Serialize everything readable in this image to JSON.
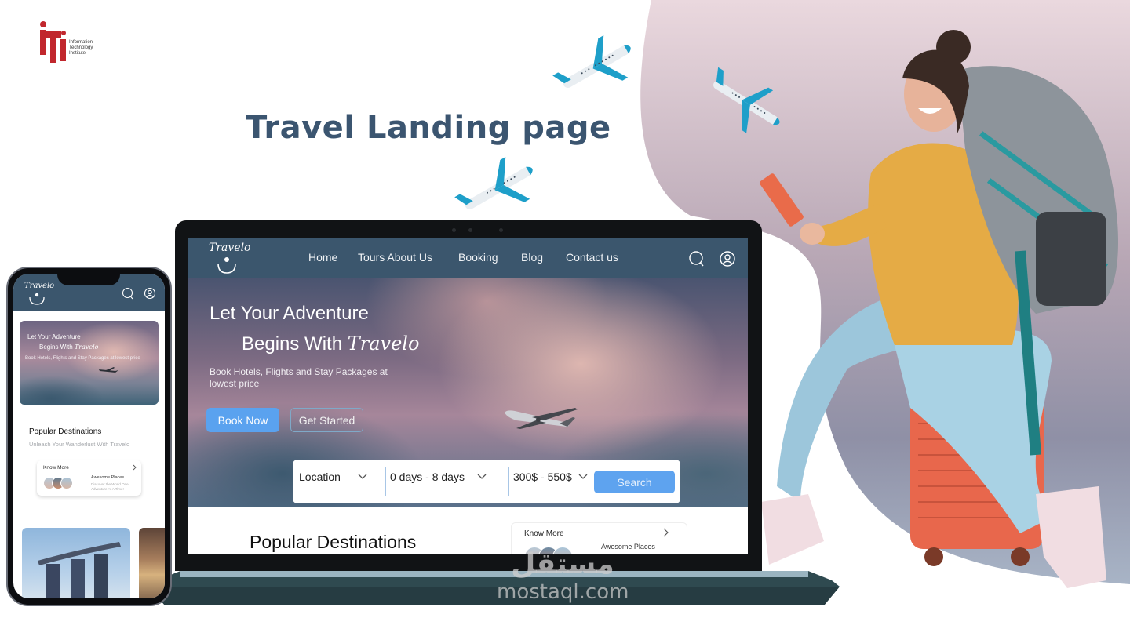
{
  "colors": {
    "nav_bg": "#3b566d",
    "title": "#3b5570",
    "primary_button": "#5aa2ef",
    "blob_top": "#e6d1da",
    "blob_bottom": "#8e8ea2",
    "iti_red": "#c1272d",
    "plane_accent": "#1e9fc9"
  },
  "institute_logo": {
    "mark": "iti",
    "lines": [
      "Information",
      "Technology",
      "Institute"
    ]
  },
  "headline": "Travel Landing page",
  "laptop_site": {
    "brand": "Travelo",
    "nav": [
      "Home",
      "Tours About Us",
      "Booking",
      "Blog",
      "Contact us"
    ],
    "icons": [
      "search-icon",
      "user-icon"
    ],
    "hero": {
      "line1": "Let Your Adventure",
      "line2_prefix": "Begins With",
      "line2_script": "Travelo",
      "subtitle": "Book Hotels, Flights and Stay Packages at lowest price",
      "primary_button": "Book Now",
      "secondary_button": "Get Started"
    },
    "search": {
      "location": "Location",
      "duration": "0 days - 8 days",
      "price": "300$ - 550$",
      "button": "Search"
    },
    "popular_title": "Popular Destinations",
    "know_more_card": {
      "title": "Know More",
      "subtitle": "Awesome Places"
    }
  },
  "phone_site": {
    "brand": "Travelo",
    "icons": [
      "search-icon",
      "user-icon"
    ],
    "hero": {
      "line1": "Let Your Adventure",
      "line2_prefix": "Begins With",
      "line2_script": "Travelo",
      "subtitle": "Book Hotels, Flights and Stay Packages at lowest price"
    },
    "popular_title": "Popular Destinations",
    "popular_subtitle": "Unleash Your Wanderlust With Travelo",
    "know_more_card": {
      "title": "Know More",
      "subtitle": "Awesome Places",
      "description": "Discover the World One Adventure At A Time!"
    }
  },
  "watermark": {
    "arabic": "مستقل",
    "latin": "mostaql.com"
  }
}
